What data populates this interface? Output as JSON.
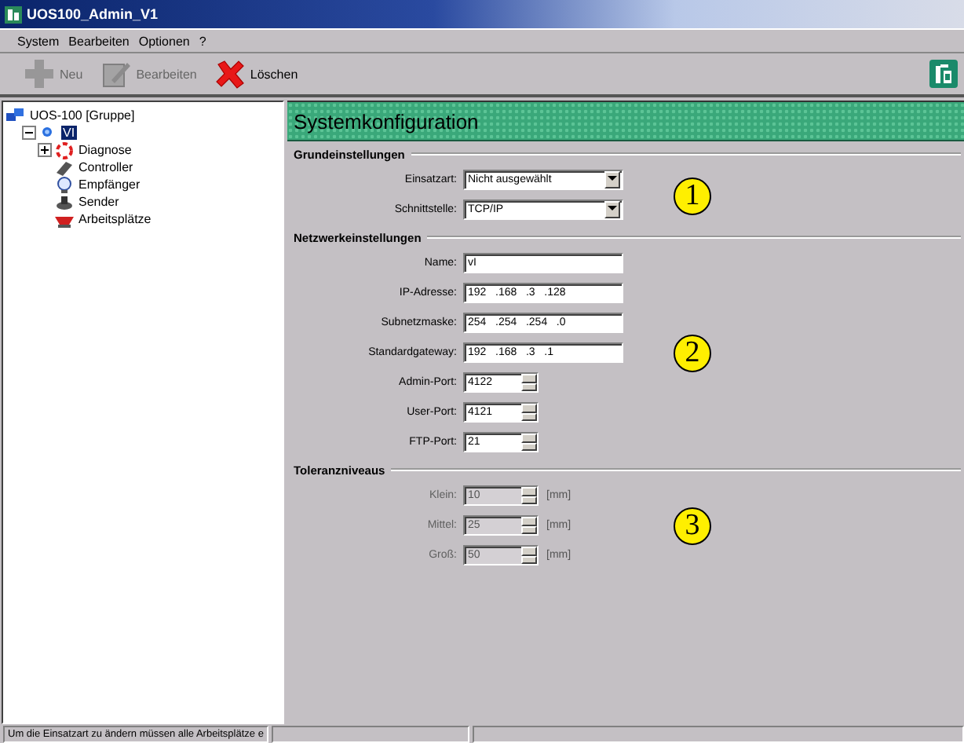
{
  "window": {
    "title": "UOS100_Admin_V1"
  },
  "menu": [
    {
      "label": "System"
    },
    {
      "label": "Bearbeiten"
    },
    {
      "label": "Optionen"
    },
    {
      "label": "?"
    }
  ],
  "toolbar": [
    {
      "kind": "new",
      "label": "Neu",
      "disabled": true
    },
    {
      "kind": "edit",
      "label": "Bearbeiten",
      "disabled": true
    },
    {
      "kind": "delete",
      "label": "Löschen",
      "disabled": false
    }
  ],
  "tree": [
    {
      "kind": "group",
      "label": "UOS-100 [Gruppe]",
      "selected": false,
      "children": [
        {
          "kind": "device",
          "label": "VI",
          "selected": true,
          "expanded": true,
          "children": [
            {
              "kind": "diagnose",
              "label": "Diagnose",
              "selected": false,
              "expanded": false
            },
            {
              "kind": "controller",
              "label": "Controller",
              "selected": false
            },
            {
              "kind": "receiver",
              "label": "Empfänger",
              "selected": false
            },
            {
              "kind": "sender",
              "label": "Sender",
              "selected": false
            },
            {
              "kind": "workplace",
              "label": "Arbeitsplätze",
              "selected": false
            }
          ]
        }
      ]
    }
  ],
  "panel": {
    "title": "Systemkonfiguration",
    "sections": [
      {
        "title": "Grundeinstellungen",
        "marker": "1",
        "fields": [
          {
            "kind": "select",
            "label": "Einsatzart:",
            "value": "Nicht ausgewählt",
            "disabled": false
          },
          {
            "kind": "select",
            "label": "Schnittstelle:",
            "value": "TCP/IP",
            "disabled": false
          }
        ]
      },
      {
        "title": "Netzwerkeinstellungen",
        "marker": "2",
        "fields": [
          {
            "kind": "text",
            "label": "Name:",
            "value": "vI",
            "disabled": false
          },
          {
            "kind": "ip",
            "label": "IP-Adresse:",
            "parts": [
              "192",
              ".168",
              ".3",
              ".128"
            ],
            "disabled": false
          },
          {
            "kind": "ip",
            "label": "Subnetzmaske:",
            "parts": [
              "254",
              ".254",
              ".254",
              ".0"
            ],
            "disabled": false
          },
          {
            "kind": "ip",
            "label": "Standardgateway:",
            "parts": [
              "192",
              ".168",
              ".3",
              ".1"
            ],
            "disabled": false
          },
          {
            "kind": "spin",
            "label": "Admin-Port:",
            "value": "4122",
            "disabled": false
          },
          {
            "kind": "spin",
            "label": "User-Port:",
            "value": "4121",
            "disabled": false
          },
          {
            "kind": "spin",
            "label": "FTP-Port:",
            "value": "21",
            "disabled": false
          }
        ]
      },
      {
        "title": "Toleranzniveaus",
        "marker": "3",
        "fields": [
          {
            "kind": "spin",
            "label": "Klein:",
            "value": "10",
            "unit": "[mm]",
            "disabled": true
          },
          {
            "kind": "spin",
            "label": "Mittel:",
            "value": "25",
            "unit": "[mm]",
            "disabled": true
          },
          {
            "kind": "spin",
            "label": "Groß:",
            "value": "50",
            "unit": "[mm]",
            "disabled": true
          }
        ]
      }
    ]
  },
  "status_bar": {
    "message": "Um die Einsatzart zu ändern müssen alle Arbeitsplätze e"
  }
}
